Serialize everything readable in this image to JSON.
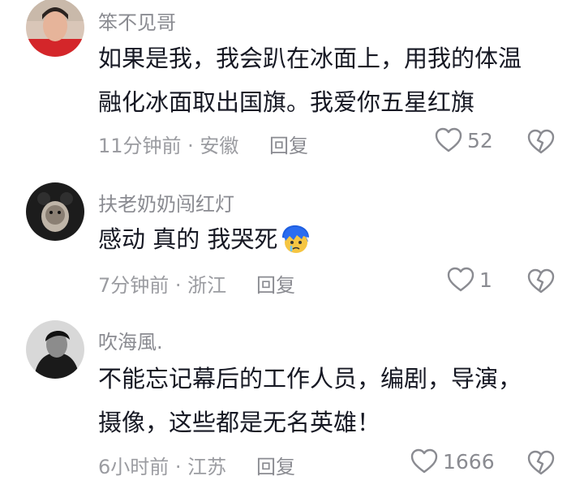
{
  "comments": [
    {
      "username": "笨不见哥",
      "lines": [
        "如果是我，我会趴在冰面上，用我的体温",
        "融化冰面取出国旗。我爱你五星红旗"
      ],
      "meta": "11分钟前 · 安徽",
      "reply_label": "回复",
      "like_count": "52",
      "avatar_icon": "avatar-photo"
    },
    {
      "username": "扶老奶奶闯红灯",
      "lines": [
        "感动 真的 我哭死"
      ],
      "emoji_icon": "crying-emoji",
      "meta": "7分钟前 · 浙江",
      "reply_label": "回复",
      "like_count": "1",
      "avatar_icon": "avatar-photo"
    },
    {
      "username": "吹海風.",
      "lines": [
        "不能忘记幕后的工作人员，编剧，导演，",
        "摄像，这些都是无名英雄！"
      ],
      "meta": "6小时前 · 江苏",
      "reply_label": "回复",
      "like_count": "1666",
      "avatar_icon": "avatar-photo"
    }
  ],
  "colors": {
    "text": "#161823",
    "secondary": "#8a8b91",
    "icon": "#8a8b91"
  }
}
